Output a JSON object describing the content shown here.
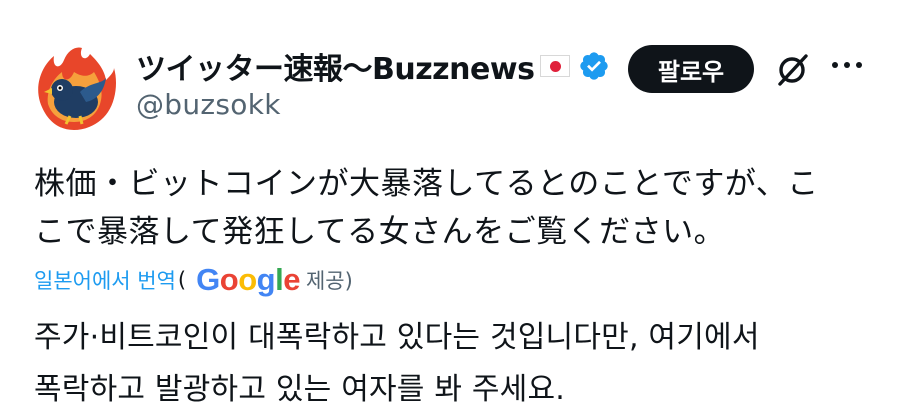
{
  "user": {
    "display_name": "ツイッター速報〜Buzznews",
    "handle": "@buzsokk",
    "flag_icon": "japan-flag-icon",
    "verified_icon": "verified-badge-icon",
    "verified_color": "#1d9bf0"
  },
  "actions": {
    "follow_label": "팔로우",
    "grok_icon": "grok-icon",
    "more_icon": "more-options-icon"
  },
  "tweet": {
    "text": "株価・ビットコインが大暴落してるとのことですが、こ\nこで暴落して発狂してる女さんをご覧ください。"
  },
  "translation": {
    "link_label": "일본어에서 번역",
    "open_paren": "(",
    "provider_label": "제공)",
    "provider_logo": "google-logo",
    "text": "주가·비트코인이 대폭락하고 있다는 것입니다만, 여기에서\n폭락하고 발광하고 있는 여자를 봐 주세요."
  }
}
